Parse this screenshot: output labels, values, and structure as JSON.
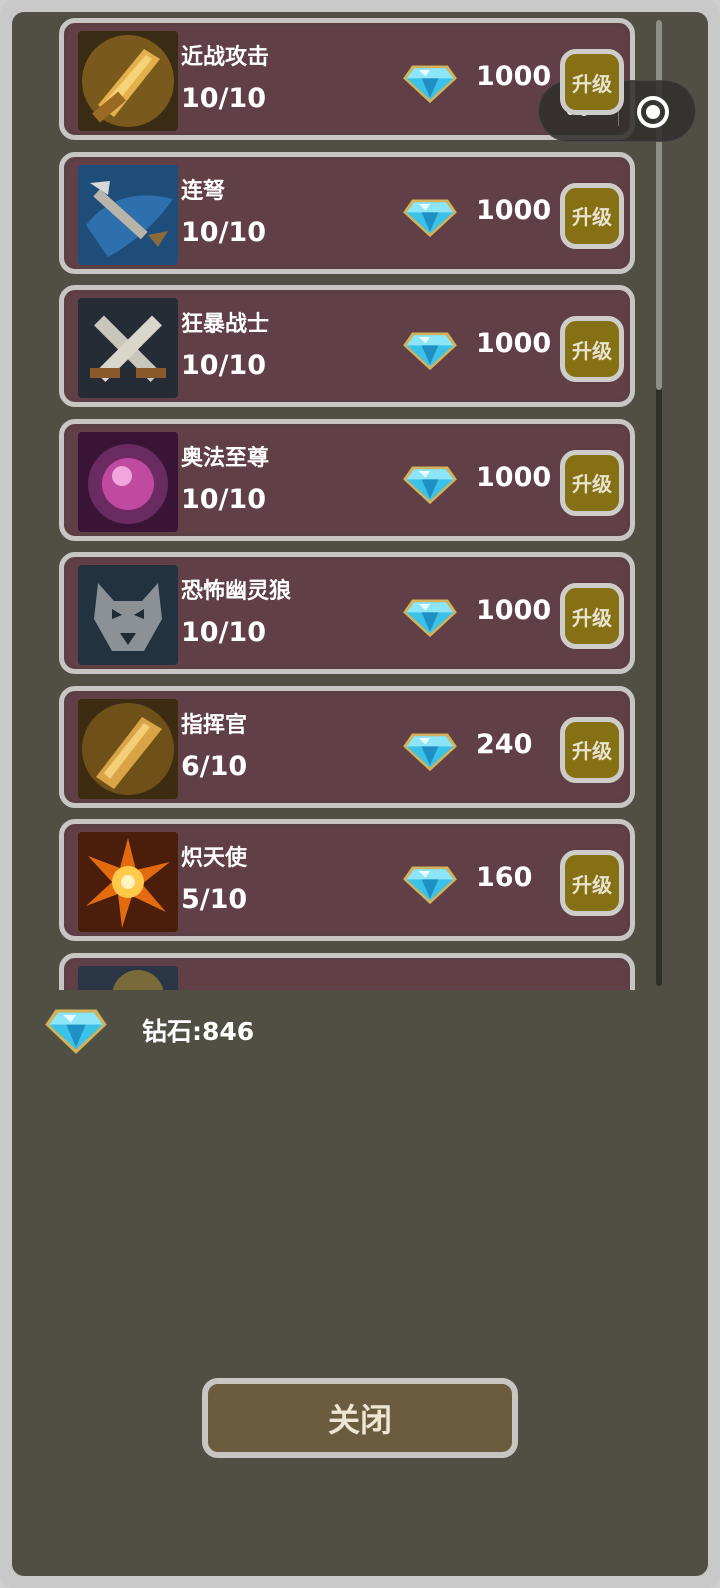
{
  "upgrades": [
    {
      "name": "近战攻击",
      "level": "10/10",
      "cost": "1000",
      "button": "升级",
      "icon": "sword-icon"
    },
    {
      "name": "连弩",
      "level": "10/10",
      "cost": "1000",
      "button": "升级",
      "icon": "crossbow-bolt-icon"
    },
    {
      "name": "狂暴战士",
      "level": "10/10",
      "cost": "1000",
      "button": "升级",
      "icon": "crossed-swords-icon"
    },
    {
      "name": "奥法至尊",
      "level": "10/10",
      "cost": "1000",
      "button": "升级",
      "icon": "arcane-orb-icon"
    },
    {
      "name": "恐怖幽灵狼",
      "level": "10/10",
      "cost": "1000",
      "button": "升级",
      "icon": "ghost-wolf-icon"
    },
    {
      "name": "指挥官",
      "level": "6/10",
      "cost": "240",
      "button": "升级",
      "icon": "commander-sword-icon"
    },
    {
      "name": "炽天使",
      "level": "5/10",
      "cost": "160",
      "button": "升级",
      "icon": "seraph-burst-icon"
    },
    {
      "name": "",
      "level": "",
      "cost": "",
      "button": "",
      "icon": "partial-item-icon"
    }
  ],
  "wallet": {
    "label": "钻石:846",
    "icon": "diamond-icon"
  },
  "close_button": "关闭",
  "capsule": {
    "more_icon": "more-dots-icon",
    "close_icon": "target-circle-icon"
  },
  "colors": {
    "panel_bg": "#514f44",
    "row_bg": "#603f46",
    "row_border": "#c8c6c2",
    "upgrade_button": "#857114",
    "close_button": "#6b5c40",
    "diamond": "#3cc2e8"
  }
}
